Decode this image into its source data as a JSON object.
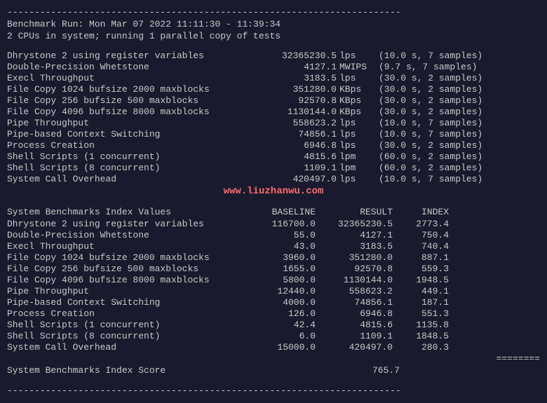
{
  "separator_top": "------------------------------------------------------------------------",
  "header": {
    "line1": "Benchmark Run: Mon Mar 07 2022 11:11:30 - 11:39:34",
    "line2": "2 CPUs in system; running 1 parallel copy of tests"
  },
  "benchmarks": [
    {
      "label": "Dhrystone 2 using register variables",
      "value": "32365230.5",
      "unit": "lps",
      "extra": " (10.0 s, 7 samples)"
    },
    {
      "label": "Double-Precision Whetstone",
      "value": "4127.1",
      "unit": "MWIPS",
      "extra": "(9.7 s, 7 samples)"
    },
    {
      "label": "Execl Throughput",
      "value": "3183.5",
      "unit": "lps",
      "extra": " (30.0 s, 2 samples)"
    },
    {
      "label": "File Copy 1024 bufsize 2000 maxblocks",
      "value": "351280.0",
      "unit": "KBps",
      "extra": "(30.0 s, 2 samples)"
    },
    {
      "label": "File Copy 256 bufsize 500 maxblocks",
      "value": "92570.8",
      "unit": "KBps",
      "extra": "(30.0 s, 2 samples)"
    },
    {
      "label": "File Copy 4096 bufsize 8000 maxblocks",
      "value": "1130144.0",
      "unit": "KBps",
      "extra": "(30.0 s, 2 samples)"
    },
    {
      "label": "Pipe Throughput",
      "value": "558623.2",
      "unit": "lps",
      "extra": " (10.0 s, 7 samples)"
    },
    {
      "label": "Pipe-based Context Switching",
      "value": "74856.1",
      "unit": "lps",
      "extra": " (10.0 s, 7 samples)"
    },
    {
      "label": "Process Creation",
      "value": "6946.8",
      "unit": "lps",
      "extra": " (30.0 s, 2 samples)"
    },
    {
      "label": "Shell Scripts (1 concurrent)",
      "value": "4815.6",
      "unit": "lpm",
      "extra": " (60.0 s, 2 samples)"
    },
    {
      "label": "Shell Scripts (8 concurrent)",
      "value": "1109.1",
      "unit": "lpm",
      "extra": " (60.0 s, 2 samples)"
    },
    {
      "label": "System Call Overhead",
      "value": "420497.0",
      "unit": "lps",
      "extra": " (10.0 s, 7 samples)"
    }
  ],
  "watermark": "www.liuzhanwu.com",
  "index_header": {
    "label": "System Benchmarks Index Values",
    "baseline": "BASELINE",
    "result": "RESULT",
    "index": "INDEX"
  },
  "index_rows": [
    {
      "label": "Dhrystone 2 using register variables",
      "baseline": "116700.0",
      "result": "32365230.5",
      "index": "2773.4"
    },
    {
      "label": "Double-Precision Whetstone",
      "baseline": "55.0",
      "result": "4127.1",
      "index": "750.4"
    },
    {
      "label": "Execl Throughput",
      "baseline": "43.0",
      "result": "3183.5",
      "index": "740.4"
    },
    {
      "label": "File Copy 1024 bufsize 2000 maxblocks",
      "baseline": "3960.0",
      "result": "351280.0",
      "index": "887.1"
    },
    {
      "label": "File Copy 256 bufsize 500 maxblocks",
      "baseline": "1655.0",
      "result": "92570.8",
      "index": "559.3"
    },
    {
      "label": "File Copy 4096 bufsize 8000 maxblocks",
      "baseline": "5800.0",
      "result": "1130144.0",
      "index": "1948.5"
    },
    {
      "label": "Pipe Throughput",
      "baseline": "12440.0",
      "result": "558623.2",
      "index": "449.1"
    },
    {
      "label": "Pipe-based Context Switching",
      "baseline": "4000.0",
      "result": "74856.1",
      "index": "187.1"
    },
    {
      "label": "Process Creation",
      "baseline": "126.0",
      "result": "6946.8",
      "index": "551.3"
    },
    {
      "label": "Shell Scripts (1 concurrent)",
      "baseline": "42.4",
      "result": "4815.6",
      "index": "1135.8"
    },
    {
      "label": "Shell Scripts (8 concurrent)",
      "baseline": "6.0",
      "result": "1109.1",
      "index": "1848.5"
    },
    {
      "label": "System Call Overhead",
      "baseline": "15000.0",
      "result": "420497.0",
      "index": "280.3"
    }
  ],
  "equals_line": "========",
  "score": {
    "label": "System Benchmarks Index Score",
    "value": "765.7"
  },
  "separator_bottom": "------------------------------------------------------------------------"
}
